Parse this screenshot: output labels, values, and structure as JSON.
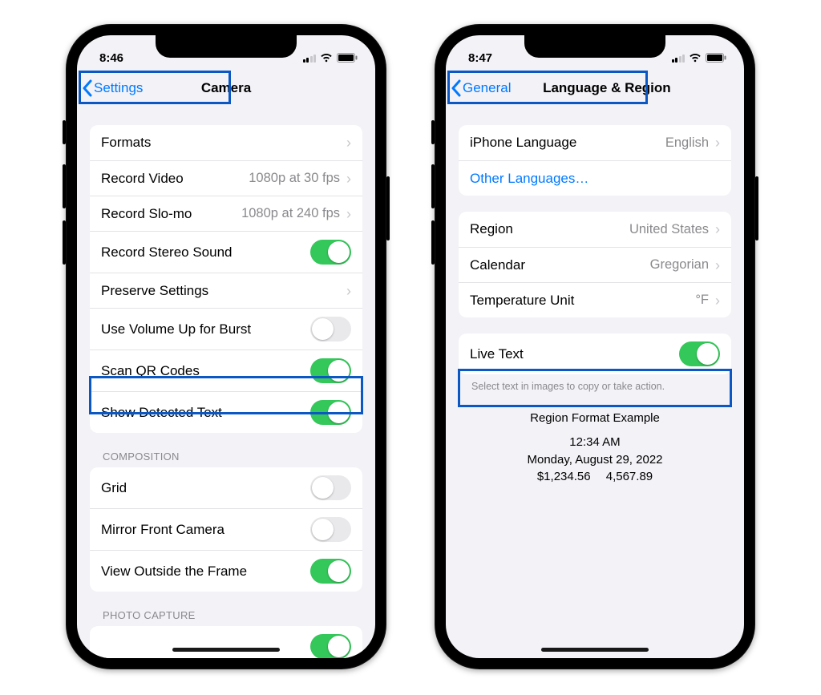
{
  "left": {
    "status_time": "8:46",
    "nav_back": "Settings",
    "nav_title": "Camera",
    "group1": [
      {
        "label": "Formats",
        "value": "",
        "type": "disclosure"
      },
      {
        "label": "Record Video",
        "value": "1080p at 30 fps",
        "type": "disclosure"
      },
      {
        "label": "Record Slo-mo",
        "value": "1080p at 240 fps",
        "type": "disclosure"
      },
      {
        "label": "Record Stereo Sound",
        "type": "toggle",
        "on": true
      },
      {
        "label": "Preserve Settings",
        "value": "",
        "type": "disclosure"
      },
      {
        "label": "Use Volume Up for Burst",
        "type": "toggle",
        "on": false
      },
      {
        "label": "Scan QR Codes",
        "type": "toggle",
        "on": true
      },
      {
        "label": "Show Detected Text",
        "type": "toggle",
        "on": true
      }
    ],
    "section2_header": "COMPOSITION",
    "group2": [
      {
        "label": "Grid",
        "type": "toggle",
        "on": false
      },
      {
        "label": "Mirror Front Camera",
        "type": "toggle",
        "on": false
      },
      {
        "label": "View Outside the Frame",
        "type": "toggle",
        "on": true
      }
    ],
    "section3_header": "PHOTO CAPTURE"
  },
  "right": {
    "status_time": "8:47",
    "nav_back": "General",
    "nav_title": "Language & Region",
    "group1": [
      {
        "label": "iPhone Language",
        "value": "English",
        "type": "disclosure"
      },
      {
        "label": "Other Languages…",
        "type": "link"
      }
    ],
    "group2": [
      {
        "label": "Region",
        "value": "United States",
        "type": "disclosure"
      },
      {
        "label": "Calendar",
        "value": "Gregorian",
        "type": "disclosure"
      },
      {
        "label": "Temperature Unit",
        "value": "°F",
        "type": "disclosure"
      }
    ],
    "group3": [
      {
        "label": "Live Text",
        "type": "toggle",
        "on": true
      }
    ],
    "group3_footer": "Select text in images to copy or take action.",
    "example": {
      "title": "Region Format Example",
      "time": "12:34 AM",
      "date": "Monday, August 29, 2022",
      "numbers": "$1,234.56  4,567.89"
    }
  }
}
